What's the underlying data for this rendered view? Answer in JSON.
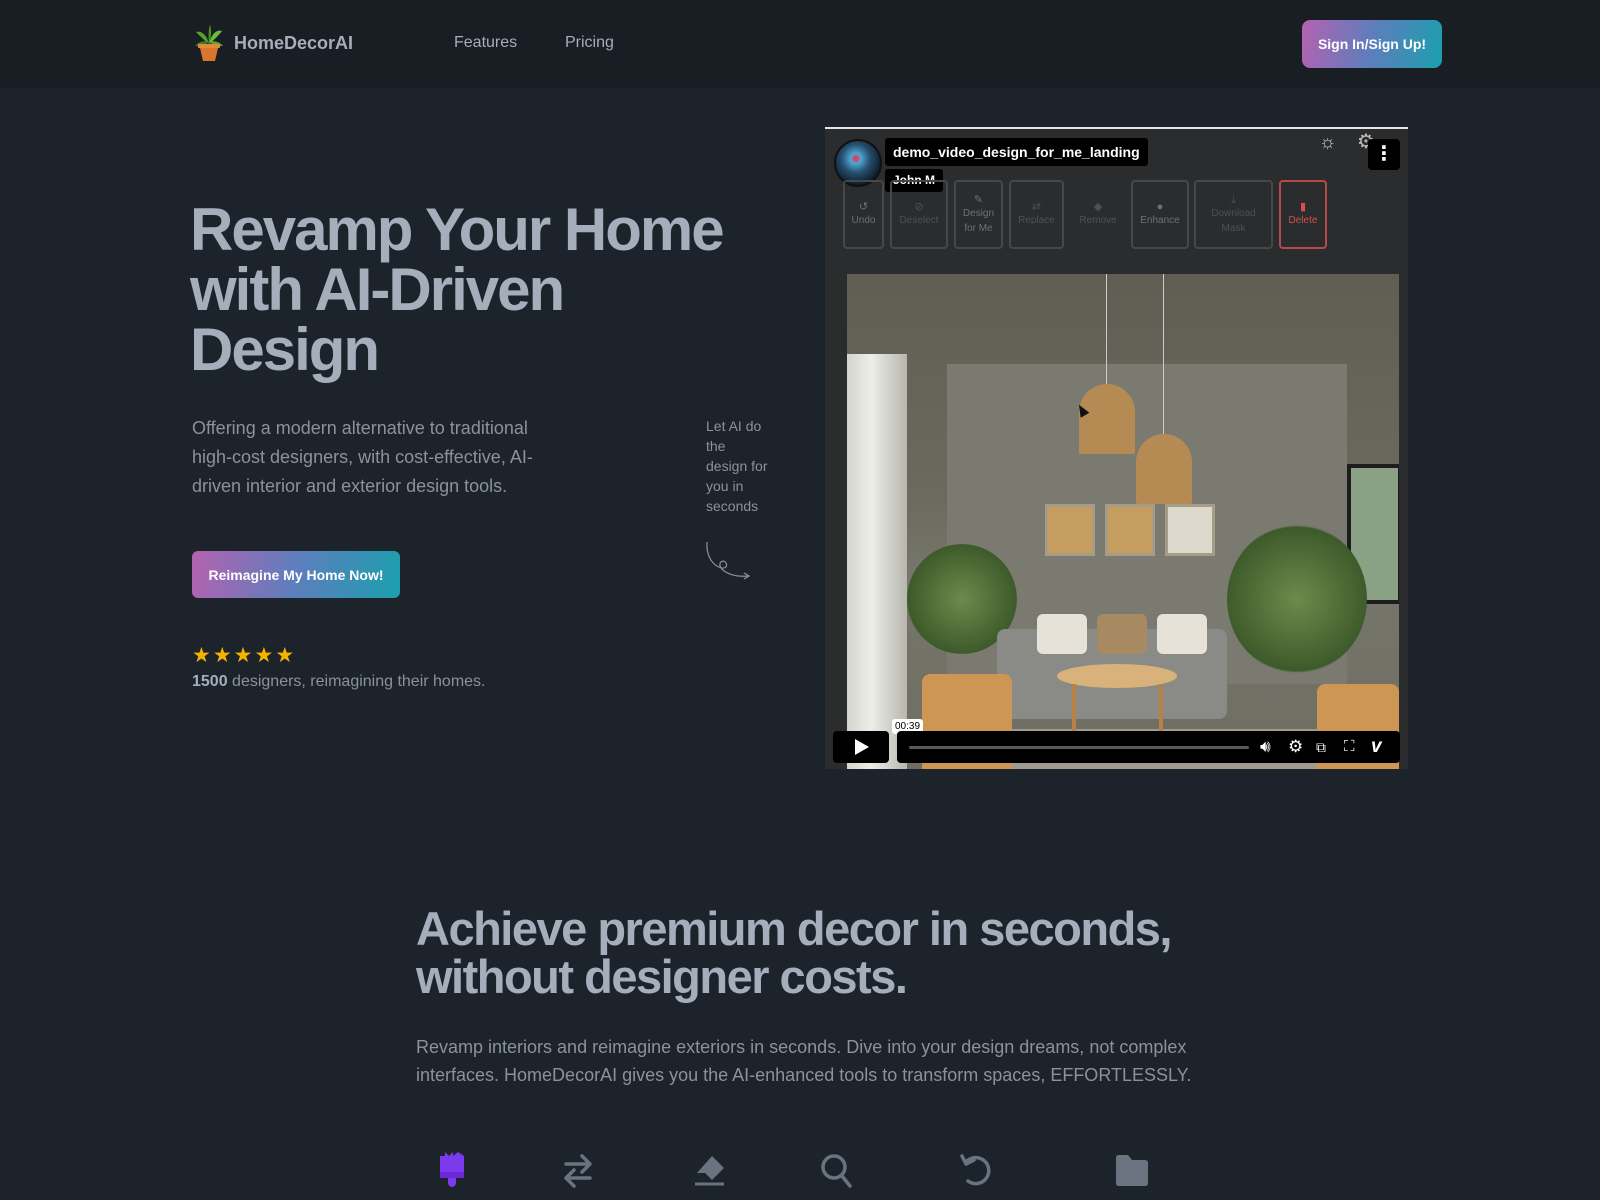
{
  "navbar": {
    "brand_name": "HomeDecorAI",
    "brand_icon": "potted-plant-icon",
    "links": [
      {
        "label": "Features"
      },
      {
        "label": "Pricing"
      }
    ],
    "signin_label": "Sign In/Sign Up!"
  },
  "hero": {
    "title": "Revamp Your Home with AI-Driven Design",
    "subtitle": "Offering a modern alternative to traditional high-cost designers, with cost-effective, AI-driven interior and exterior design tools.",
    "side_note": "Let AI do the design for you in seconds",
    "cta_label": "Reimagine My Home Now!",
    "rating": {
      "stars": 5,
      "max_stars": 5,
      "count": "1500",
      "text": " designers, reimagining their homes."
    }
  },
  "video": {
    "title": "demo_video_design_for_me_landing",
    "author": "John M",
    "toolbar": [
      {
        "label": "Undo",
        "icon": "undo-icon",
        "icon_glyph": "↺",
        "state": "normal"
      },
      {
        "label": "Deselect",
        "icon": "deselect-icon",
        "icon_glyph": "⊘",
        "state": "disabled"
      },
      {
        "label": "Design\nfor Me",
        "icon": "magic-wand-icon",
        "icon_glyph": "✎",
        "state": "normal"
      },
      {
        "label": "Replace",
        "icon": "replace-icon",
        "icon_glyph": "⇄",
        "state": "disabled"
      },
      {
        "label": "Remove",
        "icon": "eraser-icon",
        "icon_glyph": "◆",
        "state": "disabled"
      },
      {
        "label": "Enhance",
        "icon": "enhance-icon",
        "icon_glyph": "●",
        "state": "normal"
      },
      {
        "label": "Download\nMask",
        "icon": "download-icon",
        "icon_glyph": "⤓",
        "state": "disabled"
      },
      {
        "label": "Delete",
        "icon": "trash-icon",
        "icon_glyph": "▮",
        "state": "danger"
      }
    ],
    "player": {
      "time_tooltip": "00:39",
      "progress_percent": 0,
      "controls": [
        "volume-icon",
        "settings-icon",
        "pip-icon",
        "fullscreen-icon",
        "vimeo-logo-icon"
      ]
    }
  },
  "section2": {
    "title": "Achieve premium decor in seconds, without designer costs.",
    "subtitle": "Revamp interiors and reimagine exteriors in seconds. Dive into your design dreams, not complex interfaces. HomeDecorAI gives you the AI-enhanced tools to transform spaces, EFFORTLESSLY.",
    "feature_tabs": [
      {
        "icon": "paintbrush-icon",
        "active": true
      },
      {
        "icon": "swap-arrows-icon",
        "active": false
      },
      {
        "icon": "eraser-icon",
        "active": false
      },
      {
        "icon": "search-icon",
        "active": false
      },
      {
        "icon": "undo-icon",
        "active": false
      },
      {
        "icon": "folder-icon",
        "active": false
      }
    ]
  },
  "colors": {
    "background": "#1d232a",
    "navbar": "#191e24",
    "text": "#a6adbb",
    "gradient_start": "#b462b0",
    "gradient_mid": "#5d7ebd",
    "gradient_end": "#1b9fad",
    "star": "#f5b301",
    "active_feature": "#7c3aed",
    "inactive_feature": "#6b7280",
    "danger": "#d25050"
  }
}
